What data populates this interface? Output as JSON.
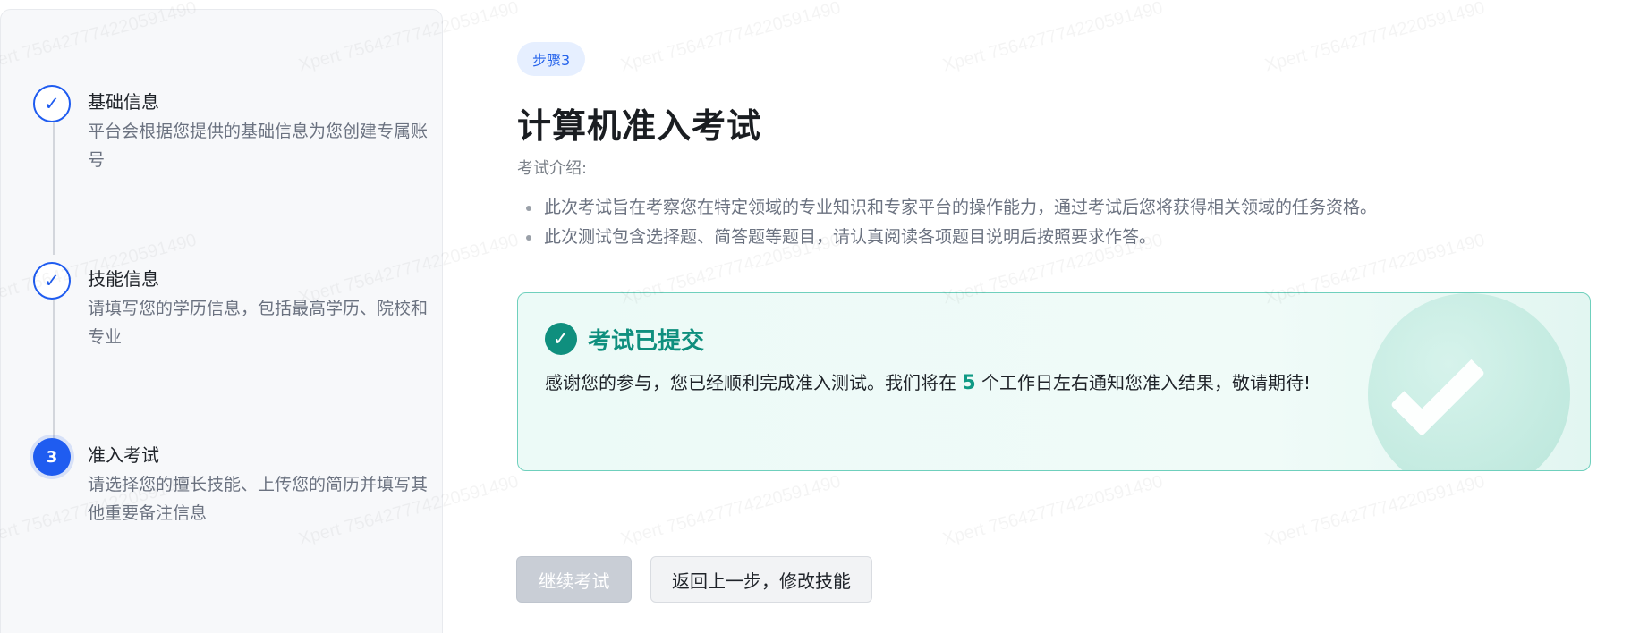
{
  "watermark": "Xpert 756427774220591490",
  "steps": [
    {
      "index": "✓",
      "title": "基础信息",
      "desc": "平台会根据您提供的基础信息为您创建专属账号",
      "state": "done"
    },
    {
      "index": "✓",
      "title": "技能信息",
      "desc": "请填写您的学历信息，包括最高学历、院校和专业",
      "state": "done"
    },
    {
      "index": "3",
      "title": "准入考试",
      "desc": "请选择您的擅长技能、上传您的简历并填写其他重要备注信息",
      "state": "active"
    }
  ],
  "badge": "步骤3",
  "title": "计算机准入考试",
  "intro": {
    "label": "考试介绍:",
    "items": [
      "此次考试旨在考察您在特定领域的专业知识和专家平台的操作能力，通过考试后您将获得相关领域的任务资格。",
      "此次测试包含选择题、简答题等题目，请认真阅读各项题目说明后按照要求作答。"
    ]
  },
  "result": {
    "icon": "✓",
    "title": "考试已提交",
    "text_before": "感谢您的参与，您已经顺利完成准入测试。我们将在 ",
    "days": "5",
    "text_after": " 个工作日左右通知您准入结果，敬请期待!"
  },
  "buttons": {
    "continue": "继续考试",
    "back": "返回上一步，修改技能"
  },
  "colors": {
    "primary": "#1f5cf0",
    "success": "#0f8f7e",
    "disabled": "#c9ced6"
  }
}
